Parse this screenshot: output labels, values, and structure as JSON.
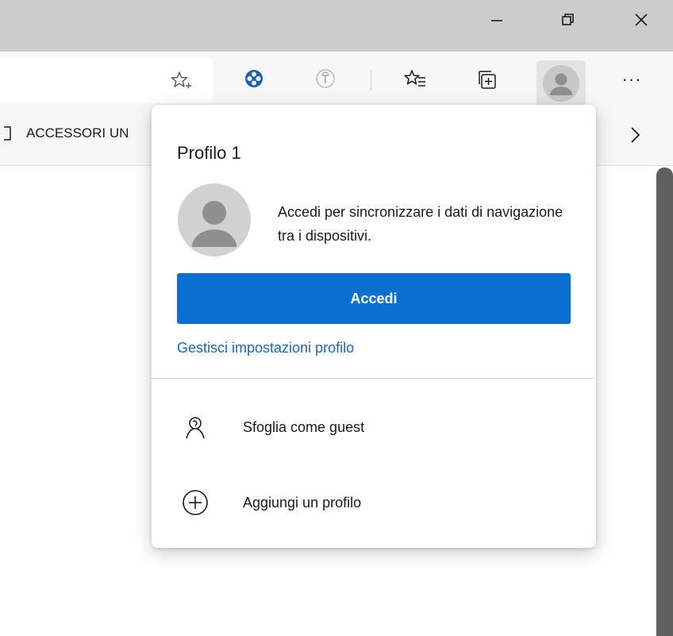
{
  "window": {
    "controls": {
      "minimize_icon": "minimize-icon",
      "restore_icon": "restore-icon",
      "close_icon": "close-icon"
    }
  },
  "toolbar": {
    "icons": [
      "star-add-icon",
      "extension-icon",
      "tracker-icon",
      "favorites-icon",
      "collections-icon",
      "profile-avatar-icon",
      "more-menu-icon"
    ],
    "more_label": "···"
  },
  "favorites_bar": {
    "item_label": "ACCESSORI UN",
    "overflow_icon": "chevron-right-icon"
  },
  "profile_flyout": {
    "title": "Profilo 1",
    "description": "Accedi per sincronizzare i dati di navigazione tra i dispositivi.",
    "signin_button": "Accedi",
    "manage_link": "Gestisci impostazioni profilo",
    "menu": [
      {
        "label": "Sfoglia come guest",
        "icon": "guest-icon"
      },
      {
        "label": "Aggiungi un profilo",
        "icon": "add-circle-icon"
      }
    ]
  },
  "colors": {
    "accent": "#0a6fd1",
    "link": "#1a66c1",
    "titlebar": "#cdcdcd",
    "toolbar": "#f7f7f7"
  }
}
